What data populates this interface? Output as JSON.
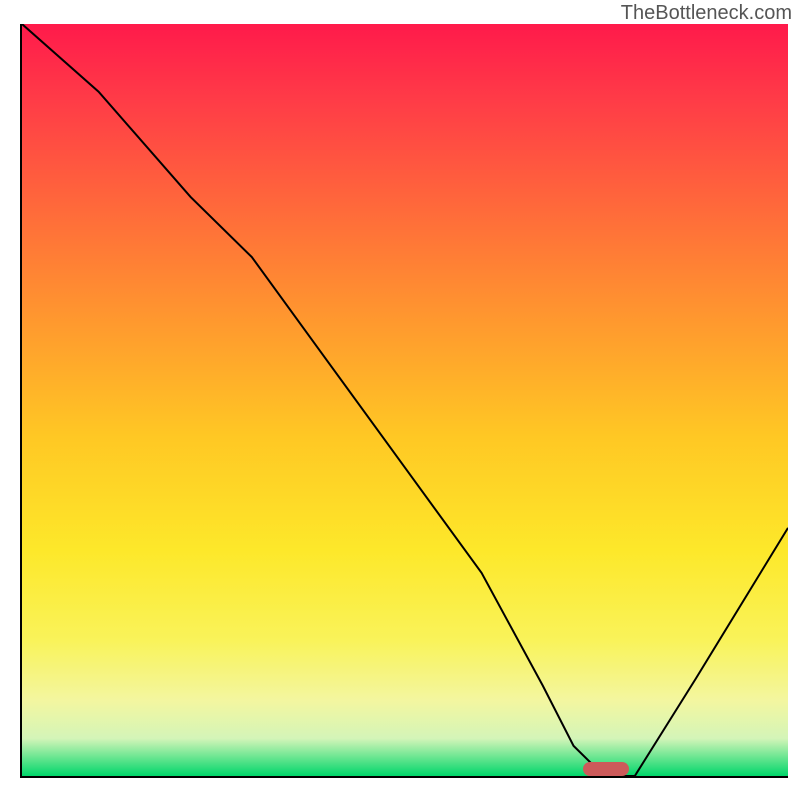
{
  "watermark": "TheBottleneck.com",
  "chart_data": {
    "type": "line",
    "title": "",
    "xlabel": "",
    "ylabel": "",
    "xlim": [
      0,
      100
    ],
    "ylim": [
      0,
      100
    ],
    "grid": false,
    "series": [
      {
        "name": "curve",
        "x": [
          0,
          10,
          22,
          30,
          40,
          50,
          60,
          68,
          72,
          76,
          80,
          88,
          100
        ],
        "values": [
          100,
          91,
          77,
          69,
          55,
          41,
          27,
          12,
          4,
          0,
          0,
          13,
          33
        ]
      }
    ],
    "marker": {
      "x_center": 76,
      "y": 0,
      "width": 6,
      "color": "#cc5a5a"
    }
  }
}
